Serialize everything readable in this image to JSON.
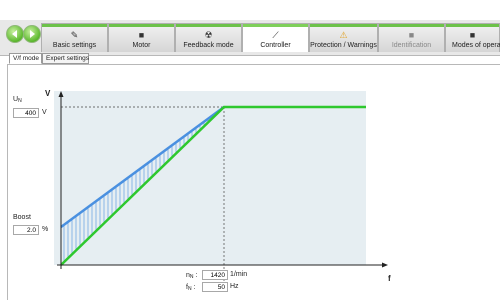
{
  "nav": {
    "back_label": "",
    "forward_label": ""
  },
  "tabs": [
    {
      "label": "Basic settings",
      "icon": "pencil-icon",
      "active": false,
      "dim": false
    },
    {
      "label": "Motor",
      "icon": "motor-icon",
      "active": false,
      "dim": false
    },
    {
      "label": "Feedback mode",
      "icon": "feedback-icon",
      "active": false,
      "dim": false
    },
    {
      "label": "Controller",
      "icon": "controller-icon",
      "active": true,
      "dim": false
    },
    {
      "label": "Protection / Warnings",
      "icon": "warning-icon",
      "active": false,
      "dim": false
    },
    {
      "label": "Identification",
      "icon": "identification-icon",
      "active": false,
      "dim": true
    },
    {
      "label": "Modes of operat",
      "icon": "modes-icon",
      "active": false,
      "dim": false
    }
  ],
  "subtabs": [
    {
      "label": "V/f mode",
      "active": true
    },
    {
      "label": "Expert settings",
      "active": false
    }
  ],
  "chart": {
    "y_axis_label": "V",
    "x_axis_label": "f",
    "un": {
      "label_main": "U",
      "label_sub": "N",
      "value": "400",
      "unit": "V"
    },
    "boost": {
      "label": "Boost",
      "value": "2.0",
      "unit": "%"
    },
    "nn": {
      "label_main": "n",
      "label_sub": "N",
      "sep": ":",
      "value": "1420",
      "unit": "1/min"
    },
    "fn": {
      "label_main": "f",
      "label_sub": "N",
      "sep": ":",
      "value": "50",
      "unit": "Hz"
    }
  },
  "colors": {
    "accent_green": "#6dc24a",
    "curve_green": "#2ec82e",
    "curve_blue": "#4a90e0",
    "plot_bg": "#e6eef2"
  }
}
